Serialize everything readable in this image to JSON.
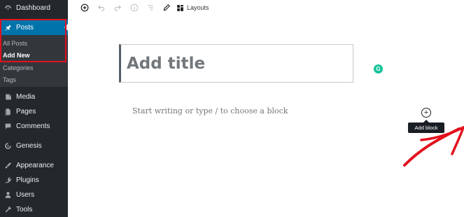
{
  "sidebar": {
    "dashboard": {
      "label": "Dashboard",
      "icon": "dashboard-icon"
    },
    "posts": {
      "label": "Posts",
      "icon": "pushpin-icon"
    },
    "submenu": [
      "All Posts",
      "Add New",
      "Categories",
      "Tags"
    ],
    "current_submenu": "Add New",
    "items": [
      {
        "label": "Media",
        "icon": "media-icon"
      },
      {
        "label": "Pages",
        "icon": "pages-icon"
      },
      {
        "label": "Comments",
        "icon": "comments-icon"
      },
      {
        "label": "Genesis",
        "icon": "genesis-icon"
      },
      {
        "label": "Appearance",
        "icon": "appearance-icon"
      },
      {
        "label": "Plugins",
        "icon": "plugins-icon"
      },
      {
        "label": "Users",
        "icon": "users-icon"
      },
      {
        "label": "Tools",
        "icon": "tools-icon"
      }
    ]
  },
  "toolbar": {
    "layouts_label": "Layouts"
  },
  "editor": {
    "title_placeholder": "Add title",
    "body_placeholder": "Start writing or type / to choose a block",
    "add_block_tooltip": "Add block",
    "grammarly_letter": "G"
  },
  "colors": {
    "sidebar_bg": "#23282d",
    "active_bg": "#0073aa",
    "highlight": "#e3101d",
    "arrow": "#e3101d"
  }
}
